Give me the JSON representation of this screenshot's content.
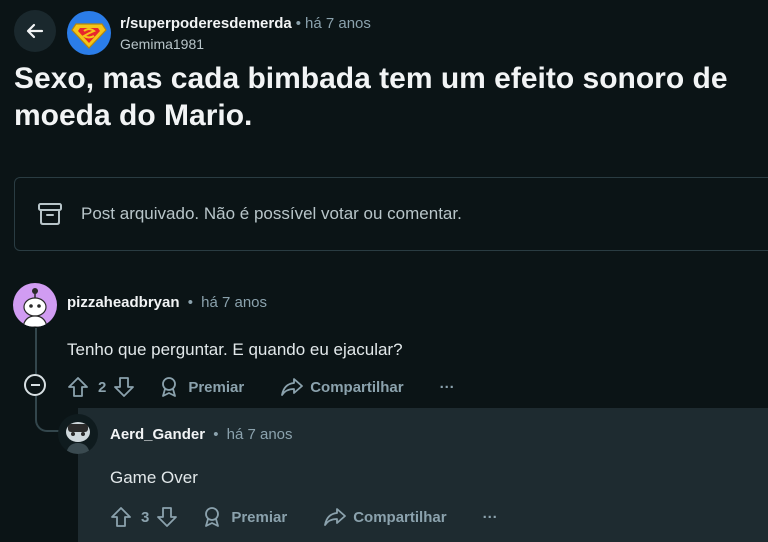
{
  "post": {
    "subreddit": "r/superpoderesdemerda",
    "time": "há 7 anos",
    "author": "Gemima1981",
    "title": "Sexo, mas cada bimbada tem um efeito sonoro de moeda do Mario.",
    "archived_notice": "Post arquivado. Não é possível votar ou comentar."
  },
  "comments": [
    {
      "user": "pizzaheadbryan",
      "time": "há 7 anos",
      "body": "Tenho que perguntar. E quando eu ejacular?",
      "votes": "2",
      "award_label": "Premiar",
      "share_label": "Compartilhar",
      "more_label": "···"
    },
    {
      "user": "Aerd_Gander",
      "time": "há 7 anos",
      "body": "Game Over",
      "votes": "3",
      "award_label": "Premiar",
      "share_label": "Compartilhar",
      "more_label": "···"
    }
  ],
  "colors": {
    "background": "#0b1416",
    "reply_background": "#1e2b30",
    "muted_text": "#8ba2ad",
    "avatar_purple": "#d19cf2"
  }
}
